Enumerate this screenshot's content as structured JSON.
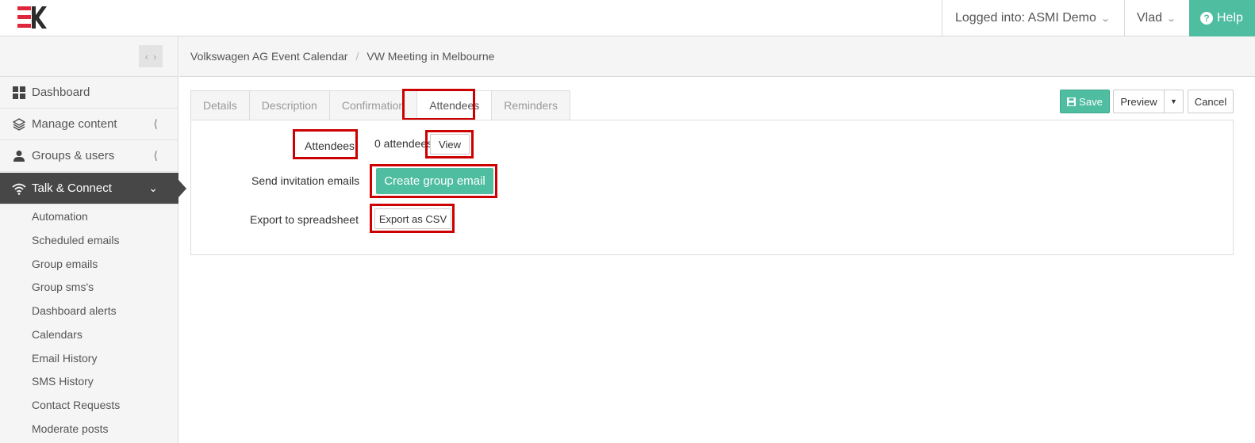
{
  "header": {
    "logged_into": "Logged into: ASMI Demo",
    "user": "Vlad",
    "help": "Help"
  },
  "sidebar": {
    "items": [
      {
        "label": "Dashboard",
        "icon": "grid-icon"
      },
      {
        "label": "Manage content",
        "icon": "layers-icon"
      },
      {
        "label": "Groups & users",
        "icon": "user-icon"
      },
      {
        "label": "Talk & Connect",
        "icon": "wifi-icon"
      }
    ],
    "sub_items": [
      "Automation",
      "Scheduled emails",
      "Group emails",
      "Group sms's",
      "Dashboard alerts",
      "Calendars",
      "Email History",
      "SMS History",
      "Contact Requests",
      "Moderate posts"
    ]
  },
  "breadcrumb": [
    "Volkswagen AG Event Calendar",
    "VW Meeting in Melbourne"
  ],
  "tabs": [
    "Details",
    "Description",
    "Confirmation",
    "Attendees",
    "Reminders"
  ],
  "toolbar": {
    "save": "Save",
    "preview": "Preview",
    "cancel": "Cancel"
  },
  "form": {
    "attendees_label": "Attendees",
    "attendees_count": "0 attendees",
    "view_button": "View",
    "send_label": "Send invitation emails",
    "create_button": "Create group email",
    "export_label": "Export to spreadsheet",
    "export_button": "Export as CSV"
  },
  "colors": {
    "accent": "#4fbda0",
    "highlight": "#cc0000",
    "active_nav": "#474747",
    "logo_red": "#e0263c"
  }
}
